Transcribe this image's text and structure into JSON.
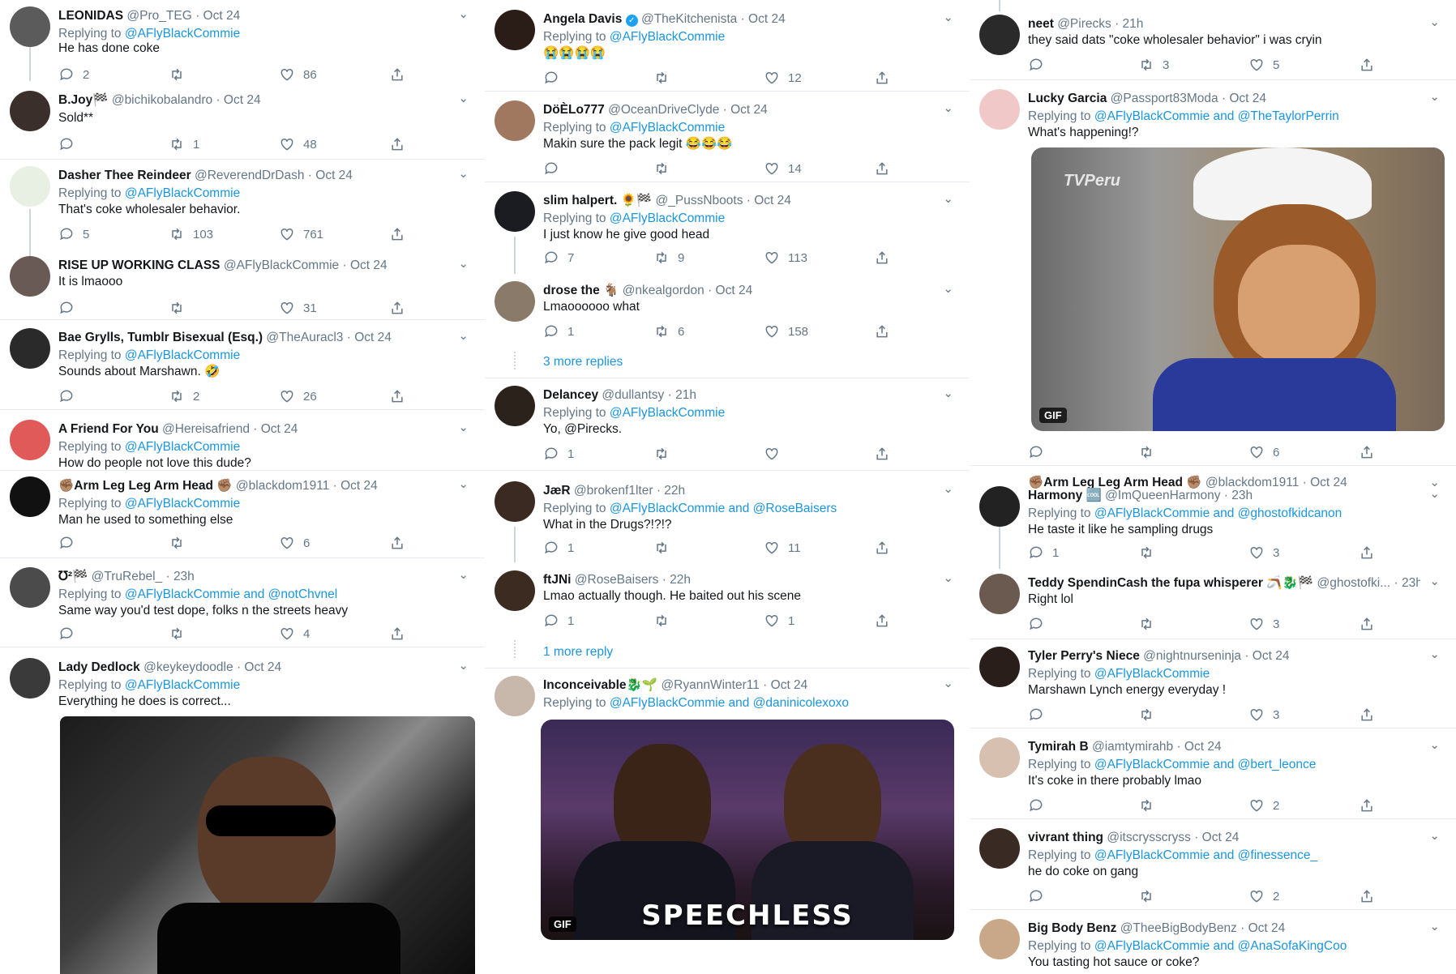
{
  "columns": [
    {
      "tweets": [
        {
          "name": "LEONIDAS",
          "handle": "@Pro_TEG",
          "date": "Oct 24",
          "replying_prefix": "Replying to ",
          "replying": "@AFlyBlackCommie",
          "text": "He has done coke",
          "replies": "2",
          "retweets": "",
          "likes": "86"
        },
        {
          "name": "B.Joy🏁",
          "handle": "@bichikobalandro",
          "date": "Oct 24",
          "replying_prefix": "",
          "replying": "",
          "text": "Sold**",
          "replies": "",
          "retweets": "1",
          "likes": "48"
        },
        {
          "name": "Dasher Thee Reindeer",
          "handle": "@ReverendDrDash",
          "date": "Oct 24",
          "replying_prefix": "Replying to ",
          "replying": "@AFlyBlackCommie",
          "text": "That's coke wholesaler behavior.",
          "replies": "5",
          "retweets": "103",
          "likes": "761"
        },
        {
          "name": "RISE UP WORKING CLASS",
          "handle": "@AFlyBlackCommie",
          "date": "Oct 24",
          "replying_prefix": "",
          "replying": "",
          "text": "It is lmaooo",
          "replies": "",
          "retweets": "",
          "likes": "31"
        },
        {
          "name": "Bae Grylls, Tumblr Bisexual (Esq.)",
          "handle": "@TheAuracl3",
          "date": "Oct 24",
          "replying_prefix": "Replying to ",
          "replying": "@AFlyBlackCommie",
          "text": "Sounds about Marshawn. 🤣",
          "replies": "",
          "retweets": "2",
          "likes": "26"
        },
        {
          "name": "A Friend For You",
          "handle": "@Hereisafriend",
          "date": "Oct 24",
          "replying_prefix": "Replying to ",
          "replying": "@AFlyBlackCommie",
          "text": "How do people not love this dude?",
          "replies": "",
          "retweets": "",
          "likes": ""
        },
        {
          "name": "✊🏽Arm Leg Leg Arm Head ✊🏽",
          "handle": "@blackdom1911",
          "date": "Oct 24",
          "replying_prefix": "Replying to ",
          "replying": "@AFlyBlackCommie",
          "text": "Man he used to something else",
          "replies": "",
          "retweets": "",
          "likes": "6"
        },
        {
          "name": "℧²🏁",
          "handle": "@TruRebel_",
          "date": "23h",
          "replying_prefix": "Replying to ",
          "replying": "@AFlyBlackCommie and @notChvnel",
          "text": "Same way you'd test dope, folks n the streets heavy",
          "replies": "",
          "retweets": "",
          "likes": "4"
        },
        {
          "name": "Lady Dedlock",
          "handle": "@keykeydoodle",
          "date": "Oct 24",
          "replying_prefix": "Replying to ",
          "replying": "@AFlyBlackCommie",
          "text": "Everything he does is correct...",
          "replies": "",
          "retweets": "",
          "likes": ""
        }
      ]
    },
    {
      "tweets": [
        {
          "name": "Angela Davis",
          "handle": "@TheKitchenista",
          "date": "Oct 24",
          "replying_prefix": "Replying to ",
          "replying": "@AFlyBlackCommie",
          "text": "😭😭😭😭",
          "replies": "",
          "retweets": "",
          "likes": "12"
        },
        {
          "name": "DöÈLo777",
          "handle": "@OceanDriveClyde",
          "date": "Oct 24",
          "replying_prefix": "Replying to ",
          "replying": "@AFlyBlackCommie",
          "text": "Makin sure the pack legit 😂😂😂",
          "replies": "",
          "retweets": "",
          "likes": "14"
        },
        {
          "name": "slim halpert. 🌻🏁",
          "handle": "@_PussNboots",
          "date": "Oct 24",
          "replying_prefix": "Replying to ",
          "replying": "@AFlyBlackCommie",
          "text": "I just know he give good head",
          "replies": "7",
          "retweets": "9",
          "likes": "113"
        },
        {
          "name": "drose the 🐐",
          "handle": "@nkealgordon",
          "date": "Oct 24",
          "replying_prefix": "",
          "replying": "",
          "text": "Lmaoooooo what",
          "replies": "1",
          "retweets": "6",
          "likes": "158"
        },
        {
          "name": "Delancey",
          "handle": "@dullantsy",
          "date": "21h",
          "replying_prefix": "Replying to ",
          "replying": "@AFlyBlackCommie",
          "text": "Yo, @Pirecks.",
          "replies": "1",
          "retweets": "",
          "likes": ""
        },
        {
          "name": "JæR",
          "handle": "@brokenf1lter",
          "date": "22h",
          "replying_prefix": "Replying to ",
          "replying": "@AFlyBlackCommie and @RoseBaisers",
          "text": "What in the Drugs?!?!?",
          "replies": "1",
          "retweets": "",
          "likes": "11"
        },
        {
          "name": "ftJNi",
          "handle": "@RoseBaisers",
          "date": "22h",
          "replying_prefix": "",
          "replying": "",
          "text": "Lmao actually though. He baited out his scene",
          "replies": "1",
          "retweets": "",
          "likes": "1"
        },
        {
          "name": "Inconceivable🐉🌱",
          "handle": "@RyannWinter11",
          "date": "Oct 24",
          "replying_prefix": "Replying to ",
          "replying": "@AFlyBlackCommie and @daninicolexoxo",
          "text": "",
          "replies": "",
          "retweets": "",
          "likes": ""
        }
      ],
      "more_replies": [
        "3 more replies",
        "1 more reply"
      ],
      "gif_caption": "SPEECHLESS",
      "gif_badge": "GIF"
    },
    {
      "tweets": [
        {
          "name": "neet",
          "handle": "@Pirecks",
          "date": "21h",
          "replying_prefix": "",
          "replying": "",
          "text": "they said dats \"coke wholesaler behavior\" i was cryin",
          "replies": "",
          "retweets": "3",
          "likes": "5"
        },
        {
          "name": "Lucky Garcia",
          "handle": "@Passport83Moda",
          "date": "Oct 24",
          "replying_prefix": "Replying to ",
          "replying": "@AFlyBlackCommie and @TheTaylorPerrin",
          "text": "What's happening!?",
          "replies": "",
          "retweets": "",
          "likes": "6"
        },
        {
          "name": "Harmony 🆒",
          "handle": "@ImQueenHarmony",
          "date": "23h",
          "replying_prefix": "Replying to ",
          "replying": "@AFlyBlackCommie and @ghostofkidcanon",
          "text": "He taste it like he sampling drugs",
          "replies": "1",
          "retweets": "",
          "likes": "3"
        },
        {
          "name": "Teddy SpendinCash the fupa whisperer 🪃🐉🏁",
          "handle": "@ghostofki...",
          "date": "23h",
          "replying_prefix": "",
          "replying": "",
          "text": "Right lol",
          "replies": "",
          "retweets": "",
          "likes": "3"
        },
        {
          "name": "Tyler Perry's Niece",
          "handle": "@nightnurseninja",
          "date": "Oct 24",
          "replying_prefix": "Replying to ",
          "replying": "@AFlyBlackCommie",
          "text": "Marshawn Lynch energy everyday !",
          "replies": "",
          "retweets": "",
          "likes": "3"
        },
        {
          "name": "Tymirah B",
          "handle": "@iamtymirahb",
          "date": "Oct 24",
          "replying_prefix": "Replying to ",
          "replying": "@AFlyBlackCommie and @bert_leonce",
          "text": "It's coke in there probably lmao",
          "replies": "",
          "retweets": "",
          "likes": "2"
        },
        {
          "name": "vivrant thing",
          "handle": "@itscrysscryss",
          "date": "Oct 24",
          "replying_prefix": "Replying to ",
          "replying": "@AFlyBlackCommie and @finessence_",
          "text": "he do coke on gang",
          "replies": "",
          "retweets": "",
          "likes": "2"
        },
        {
          "name": "Big Body Benz",
          "handle": "@TheeBigBodyBenz",
          "date": "Oct 24",
          "replying_prefix": "Replying to ",
          "replying": "@AFlyBlackCommie and @AnaSofaKingCoo",
          "text": "You tasting hot sauce or coke?",
          "replies": "",
          "retweets": "",
          "likes": ""
        }
      ],
      "overlap_name": "✊🏽Arm Leg Leg Arm Head ✊🏽",
      "overlap_handle": "@blackdom1911 · Oct 24",
      "gif_watermark": "TVPeru",
      "gif_badge": "GIF"
    }
  ],
  "colors": {
    "link": "#1b95e0",
    "muted": "#657786",
    "divider": "#e6ecf0",
    "thread": "#ccd6dd"
  },
  "icons": [
    "reply-icon",
    "retweet-icon",
    "like-icon",
    "share-icon",
    "chevron-down-icon",
    "verified-badge-icon"
  ]
}
